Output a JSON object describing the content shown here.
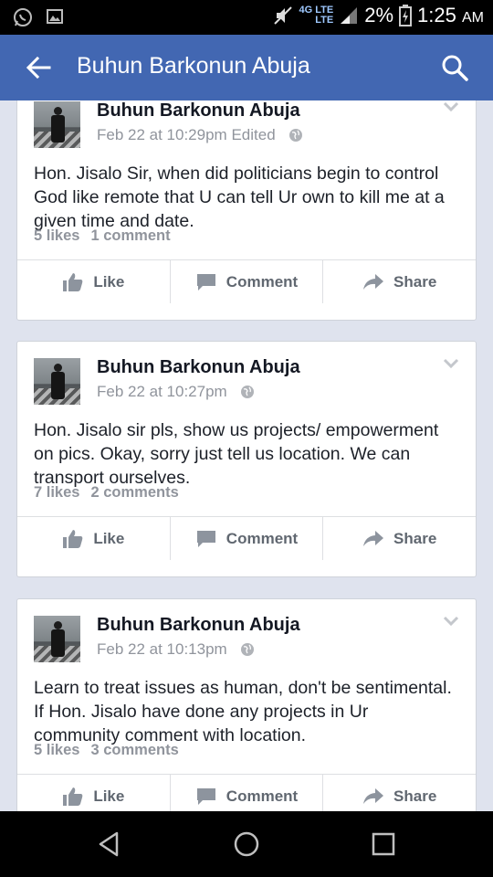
{
  "status_bar": {
    "network_top": "4G LTE",
    "network_bottom": "LTE",
    "battery": "2%",
    "time": "1:25",
    "ampm": "AM"
  },
  "app_bar": {
    "title": "Buhun Barkonun Abuja"
  },
  "posts": [
    {
      "author": "Buhun Barkonun Abuja",
      "timestamp": "Feb 22 at 10:29pm",
      "edited": "Edited",
      "text": "Hon. Jisalo Sir, when did politicians begin to control God like remote that U can tell Ur own to kill me at a given time and date.",
      "likes": "5 likes",
      "comments": "1 comment"
    },
    {
      "author": "Buhun Barkonun Abuja",
      "timestamp": "Feb 22 at 10:27pm",
      "edited": "",
      "text": "Hon. Jisalo sir pls, show us projects/ empowerment on pics. Okay, sorry just tell us location. We can transport ourselves.",
      "likes": "7 likes",
      "comments": "2 comments"
    },
    {
      "author": "Buhun Barkonun Abuja",
      "timestamp": "Feb 22 at 10:13pm",
      "edited": "",
      "text": "Learn to treat issues as human, don't be sentimental. If Hon. Jisalo have done any projects in Ur community comment with location.",
      "likes": "5 likes",
      "comments": "3 comments"
    }
  ],
  "actions": {
    "like": "Like",
    "comment": "Comment",
    "share": "Share"
  },
  "icons": {
    "back": "arrow-left-icon",
    "search": "search-icon",
    "globe": "globe-icon",
    "like": "thumbs-up-icon",
    "comment": "speech-bubble-icon",
    "share": "share-arrow-icon"
  },
  "colors": {
    "app_bar": "#4267b2",
    "feed_bg": "#dfe3ee",
    "muted_text": "#90949c",
    "action_text": "#606770"
  }
}
